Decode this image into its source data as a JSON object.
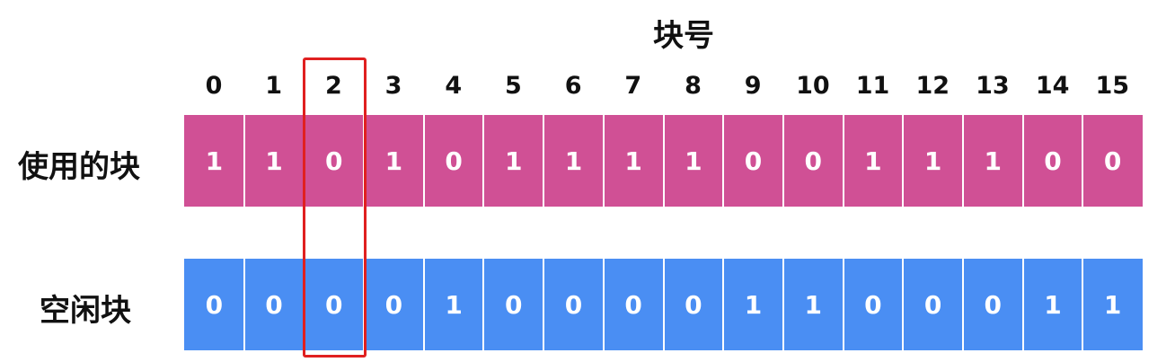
{
  "title": "块号",
  "block_numbers": [
    "0",
    "1",
    "2",
    "3",
    "4",
    "5",
    "6",
    "7",
    "8",
    "9",
    "10",
    "11",
    "12",
    "13",
    "14",
    "15"
  ],
  "rows": [
    {
      "id": "used",
      "label": "使用的块",
      "color": "#d05095",
      "values": [
        "1",
        "1",
        "0",
        "1",
        "0",
        "1",
        "1",
        "1",
        "1",
        "0",
        "0",
        "1",
        "1",
        "1",
        "0",
        "0"
      ]
    },
    {
      "id": "free",
      "label": "空闲块",
      "color": "#4a8ef3",
      "values": [
        "0",
        "0",
        "0",
        "0",
        "1",
        "0",
        "0",
        "0",
        "0",
        "1",
        "1",
        "0",
        "0",
        "0",
        "1",
        "1"
      ]
    }
  ],
  "highlight": {
    "block_number": "2",
    "color": "#e02020"
  }
}
